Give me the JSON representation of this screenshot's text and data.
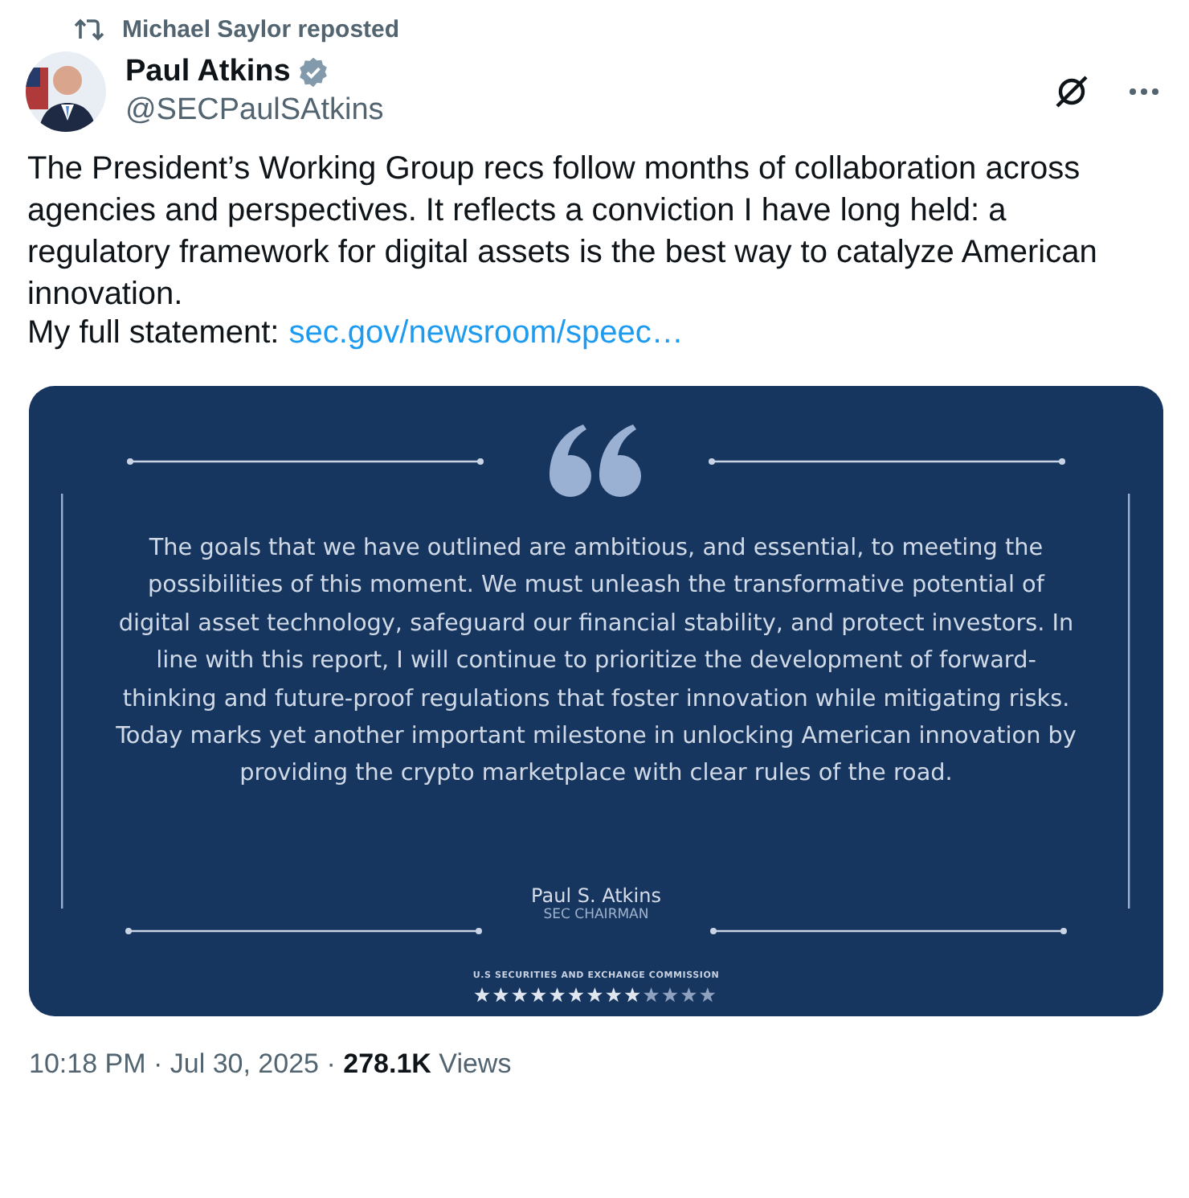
{
  "repost": {
    "text": "Michael Saylor reposted"
  },
  "author": {
    "name": "Paul Atkins",
    "verified": true,
    "handle": "@SECPaulSAtkins"
  },
  "body": {
    "text": "The President’s Working Group recs follow months of collaboration across agencies and perspectives. It reflects a conviction I have long held: a regulatory framework for digital assets is the best way to catalyze American innovation.",
    "statement_label": "My full statement:",
    "link": "sec.gov/newsroom/speec…"
  },
  "quote_card": {
    "quote": "The goals that we have outlined are ambitious, and essential, to meeting the possibilities of this moment. We must unleash the transformative potential of digital asset technology, safeguard our financial stability, and protect investors. In line with this report, I will continue to prioritize the development of forward-thinking and future-proof regulations that foster innovation while mitigating risks. Today marks yet another important milestone in unlocking American innovation by providing the crypto marketplace with clear rules of the road.",
    "signer": "Paul S. Atkins",
    "signer_title": "SEC CHAIRMAN",
    "agency": "U.S SECURITIES AND EXCHANGE COMMISSION"
  },
  "meta": {
    "text": "10:18 PM · Jul 30, 2025 · **278.1K** Views"
  }
}
